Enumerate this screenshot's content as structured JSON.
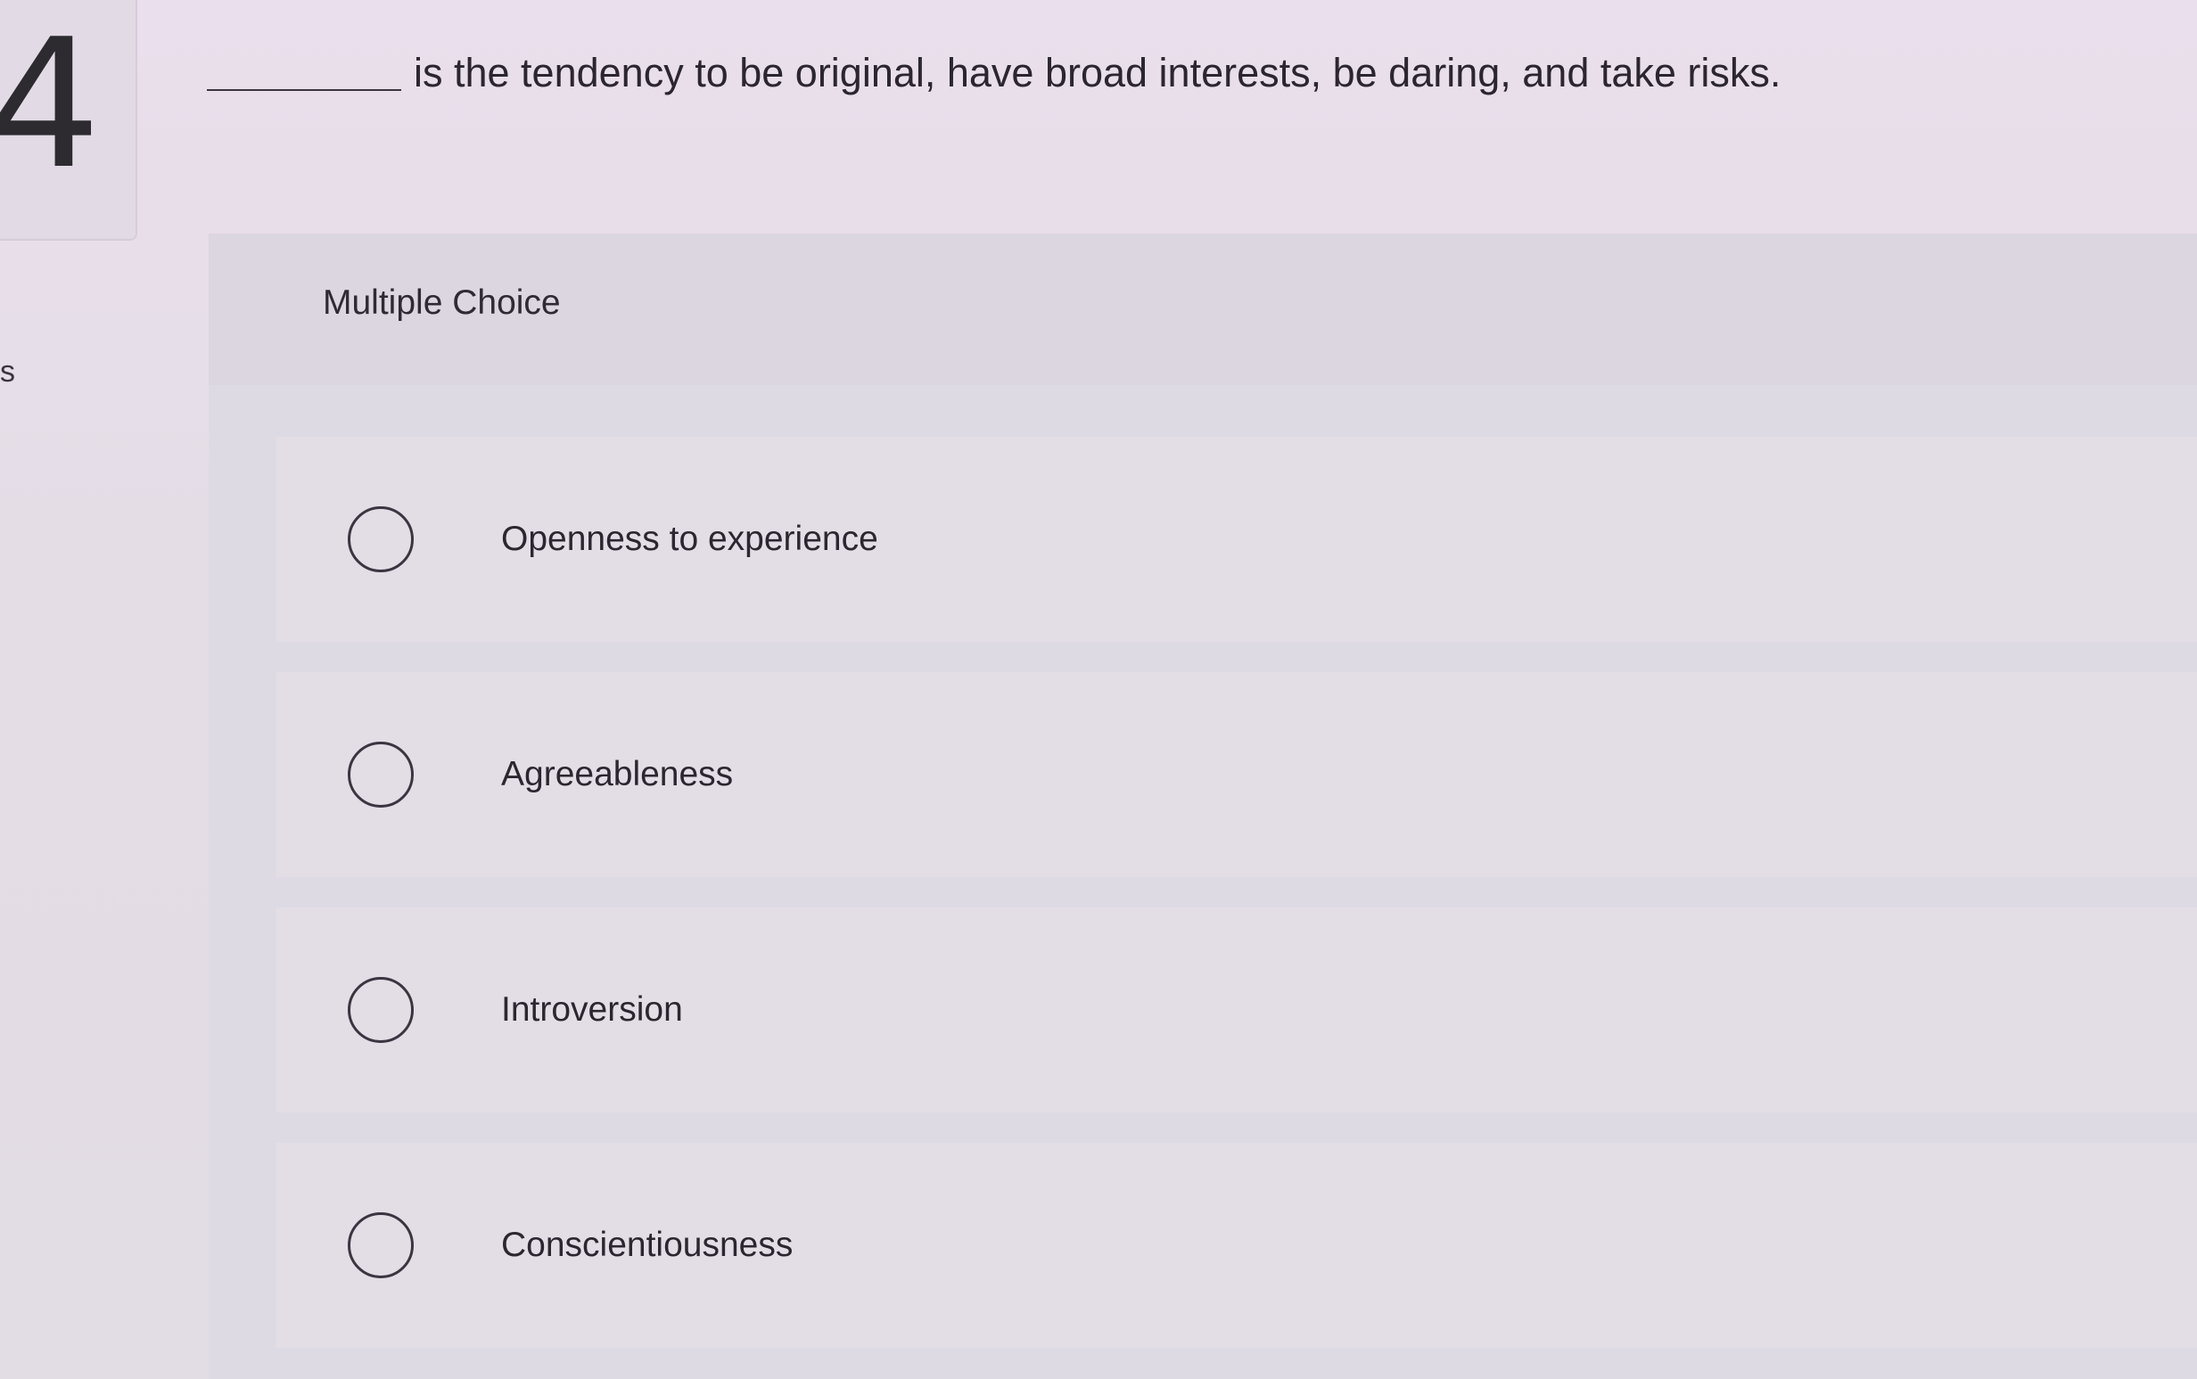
{
  "question": {
    "number": "4",
    "side_letter": "s",
    "text": "is the tendency to be original, have broad interests, be daring, and take risks."
  },
  "answer_type": "Multiple Choice",
  "choices": [
    {
      "label": "Openness to experience"
    },
    {
      "label": "Agreeableness"
    },
    {
      "label": "Introversion"
    },
    {
      "label": "Conscientiousness"
    }
  ]
}
